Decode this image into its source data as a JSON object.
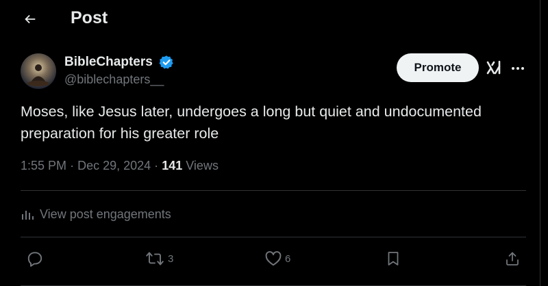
{
  "header": {
    "title": "Post"
  },
  "author": {
    "name": "BibleChapters",
    "handle": "@biblechapters__"
  },
  "header_actions": {
    "promote_label": "Promote"
  },
  "post": {
    "text": "Moses, like Jesus later, undergoes a long but quiet and undocumented preparation for his greater role",
    "time": "1:55 PM",
    "separator": "·",
    "date": "Dec 29, 2024",
    "views_count": "141",
    "views_label": "Views"
  },
  "engagements": {
    "label": "View post engagements"
  },
  "actions": {
    "retweets": "3",
    "likes": "6"
  },
  "colors": {
    "background": "#000000",
    "text": "#e7e9ea",
    "muted": "#71767b",
    "divider": "#2f3336",
    "verified": "#1d9bf0",
    "button_bg": "#eff3f4"
  },
  "icons": [
    "back-arrow-icon",
    "verified-badge-icon",
    "grok-icon",
    "more-icon",
    "analytics-icon",
    "reply-icon",
    "retweet-icon",
    "like-icon",
    "bookmark-icon",
    "share-icon"
  ]
}
